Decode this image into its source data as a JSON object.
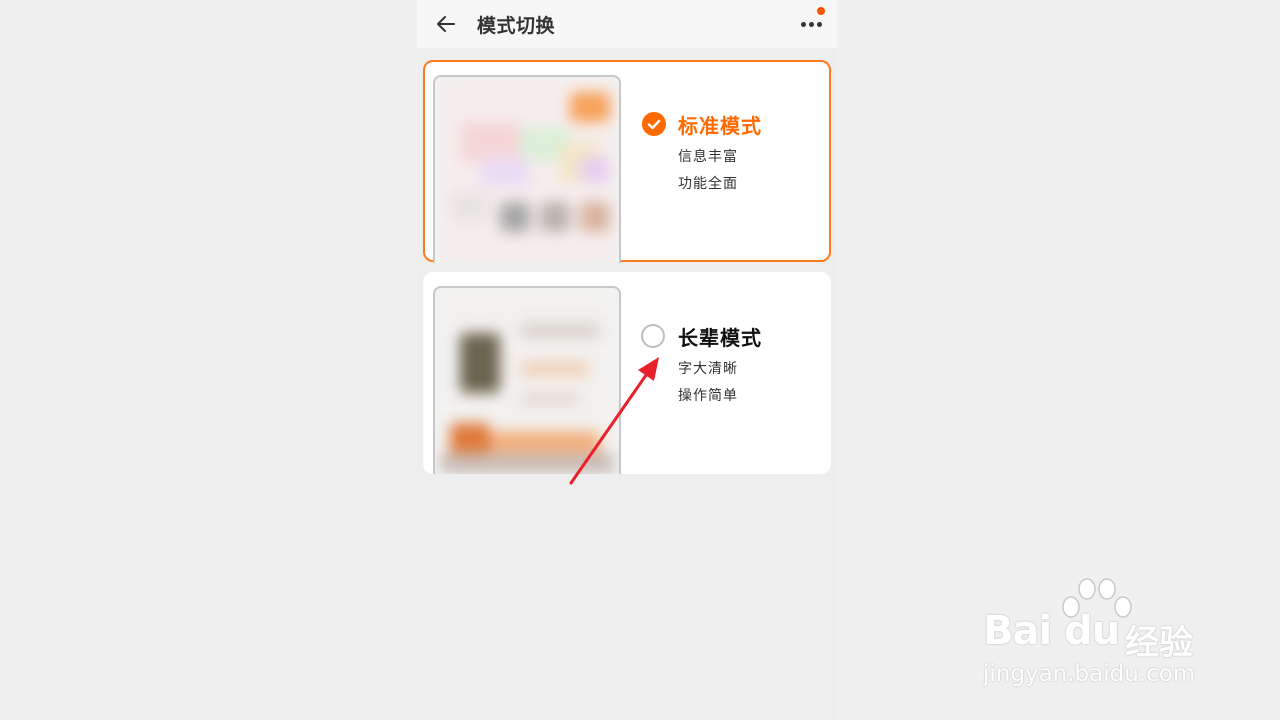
{
  "header": {
    "title": "模式切换",
    "back_icon": "arrow-left-icon",
    "more_icon": "more-dots-icon",
    "notification_color": "#ff5500"
  },
  "modes": [
    {
      "title": "标准模式",
      "line1": "信息丰富",
      "line2": "功能全面",
      "selected": true
    },
    {
      "title": "长辈模式",
      "line1": "字大清晰",
      "line2": "操作简单",
      "selected": false
    }
  ],
  "colors": {
    "accent": "#ff6a00",
    "selected_border": "#ff7a1a",
    "annotation_arrow": "#e8212b"
  },
  "watermark": {
    "brand_latin": "Bai du",
    "brand_cn": "经验",
    "url": "jingyan.baidu.com"
  }
}
